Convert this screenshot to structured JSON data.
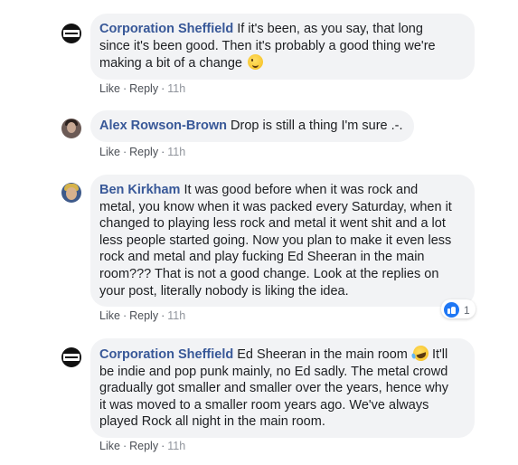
{
  "comments": [
    {
      "author": "Corporation Sheffield",
      "text": "If it's been, as you say, that long\nsince it's been good. Then it's probably a good thing we're\nmaking a bit of a change",
      "emoji": "wink-emoji",
      "like": "Like",
      "reply": "Reply",
      "time": "11h"
    },
    {
      "author": "Alex Rowson-Brown",
      "text": "Drop is still a thing I'm sure .-.",
      "like": "Like",
      "reply": "Reply",
      "time": "11h"
    },
    {
      "author": "Ben Kirkham",
      "text": "It was good before when it was rock and\nmetal, you know when it was packed every Saturday, when it\nchanged to playing less rock and metal it went shit and a lot\nless people started going. Now you plan to make it even less\nrock and metal and play fucking Ed Sheeran in the main\nroom??? That is not a good change. Look at the replies on\nyour post, literally nobody is liking the idea.",
      "reactions": {
        "icon": "thumbs-up-icon",
        "count": "1"
      },
      "like": "Like",
      "reply": "Reply",
      "time": "11h"
    },
    {
      "author": "Corporation Sheffield",
      "text_a": "Ed Sheeran in the main room",
      "emoji": "laughing-emoji",
      "text_b": "It'll\nbe indie and pop punk mainly, no Ed sadly. The metal crowd\ngradually got smaller and smaller over the years, hence why\nit was moved to a smaller room years ago. We've always\nplayed Rock all night in the main room.",
      "like": "Like",
      "reply": "Reply",
      "time": "11h"
    }
  ],
  "colors": {
    "bubble": "#f2f3f5",
    "author": "#385898",
    "meta": "#606770",
    "like_blue": "#2078f4"
  }
}
